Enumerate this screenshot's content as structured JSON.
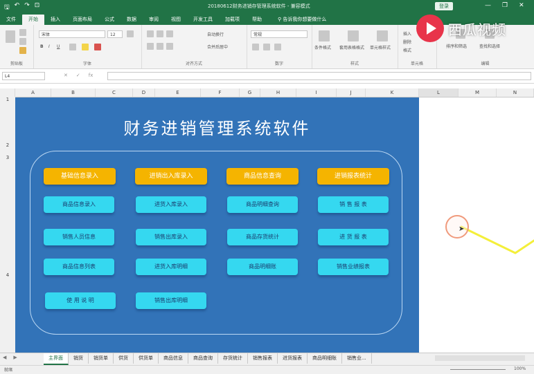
{
  "title_bar": {
    "doc_title": "20180612财务进销存管理系统软件 - 兼容模式",
    "login": "登录",
    "qat_icons": [
      "save-icon",
      "undo-icon",
      "redo-icon",
      "preview-icon"
    ],
    "win_buttons": [
      "—",
      "❐",
      "✕"
    ]
  },
  "ribbon_tabs": {
    "items": [
      "文件",
      "开始",
      "插入",
      "页面布局",
      "公式",
      "数据",
      "审阅",
      "视图",
      "开发工具",
      "加载项",
      "帮助"
    ],
    "active": "开始",
    "search_label": "告诉我你想要做什么"
  },
  "ribbon": {
    "clipboard": {
      "label": "剪贴板"
    },
    "font": {
      "label": "字体",
      "name": "宋体",
      "size": "12"
    },
    "alignment": {
      "label": "对齐方式",
      "wrap": "自动换行",
      "merge": "合并后居中"
    },
    "number": {
      "label": "数字",
      "format": "常规"
    },
    "styles": {
      "label": "样式",
      "conditional": "条件格式",
      "table": "套用表格格式",
      "cell": "单元格样式"
    },
    "cells": {
      "label": "单元格",
      "insert": "插入",
      "delete": "删除",
      "format": "格式"
    },
    "editing": {
      "label": "编辑",
      "sort": "排序和筛选",
      "find": "查找和选择"
    }
  },
  "formula_bar": {
    "name_box": "L4",
    "fx": "fx",
    "value": ""
  },
  "columns": [
    "A",
    "B",
    "C",
    "D",
    "E",
    "F",
    "G",
    "H",
    "I",
    "J",
    "K",
    "L",
    "M",
    "N"
  ],
  "rows": [
    "1",
    "2",
    "3",
    "4"
  ],
  "dashboard": {
    "title": "财务进销管理系统软件",
    "headers": [
      "基础信息录入",
      "进销出入库录入",
      "商品信息查询",
      "进销报表统计"
    ],
    "buttons": [
      [
        "商品信息录入",
        "销售人员信息",
        "商品信息列表",
        "使 用 说 明"
      ],
      [
        "进货入库录入",
        "销售出库录入",
        "进货入库明细",
        "销售出库明细"
      ],
      [
        "商品明细查询",
        "商品存货统计",
        "商品明细账"
      ],
      [
        "销 售 报 表",
        "进 货 报 表",
        "销售业绩报表"
      ]
    ],
    "colors": {
      "board": "#3273b8",
      "header": "#f5b400",
      "button": "#35d8f0"
    }
  },
  "watermark": {
    "text": "西瓜视频"
  },
  "sheet_tabs": {
    "items": [
      "主界面",
      "销货",
      "销货单",
      "供货",
      "供货单",
      "商品信息",
      "商品查询",
      "存货统计",
      "销售报表",
      "进货报表",
      "商品明细账",
      "销售业..."
    ],
    "active": "主界面"
  },
  "status_bar": {
    "ready": "就绪",
    "zoom": "100%"
  }
}
